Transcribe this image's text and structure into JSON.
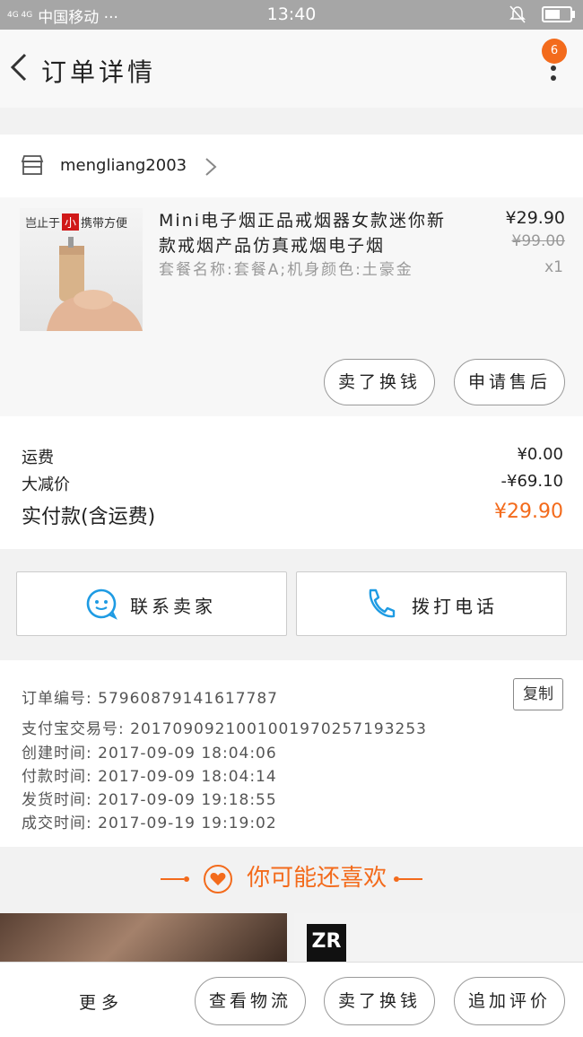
{
  "status": {
    "signal": "4G 4G",
    "carrier": "中国移动 ···",
    "time": "13:40"
  },
  "header": {
    "title": "订单详情",
    "badge": "6"
  },
  "shop": {
    "name": "mengliang2003"
  },
  "product": {
    "thumb_tag_left": "岂止于",
    "thumb_tag_red": "小",
    "thumb_tag_right": "携带方便",
    "title": "Mini电子烟正品戒烟器女款迷你新款戒烟产品仿真戒烟电子烟",
    "spec": "套餐名称:套餐A;机身颜色:土豪金",
    "price": "¥29.90",
    "old_price": "¥99.00",
    "qty": "x1",
    "buttons": [
      "卖了换钱",
      "申请售后"
    ]
  },
  "costs": {
    "shipping_label": "运费",
    "shipping_value": "¥0.00",
    "discount_label": "大减价",
    "discount_value": "-¥69.10",
    "total_label": "实付款(含运费)",
    "total_value": "¥29.90"
  },
  "contact": {
    "seller": "联系卖家",
    "call": "拨打电话"
  },
  "info": {
    "order_no": "订单编号: 57960879141617787",
    "copy": "复制",
    "alipay_no": "支付宝交易号: 2017090921001001970257193253",
    "created": "创建时间: 2017-09-09 18:04:06",
    "paid": "付款时间: 2017-09-09 18:04:14",
    "shipped": "发货时间: 2017-09-09 19:18:55",
    "completed": "成交时间: 2017-09-19 19:19:02"
  },
  "recommend": {
    "title": "你可能还喜欢",
    "brand_b": "ZR"
  },
  "bottom": {
    "more": "更多",
    "buttons": [
      "查看物流",
      "卖了换钱",
      "追加评价"
    ]
  },
  "colors": {
    "accent": "#f36b1c",
    "blue_icon": "#1e9be3"
  }
}
